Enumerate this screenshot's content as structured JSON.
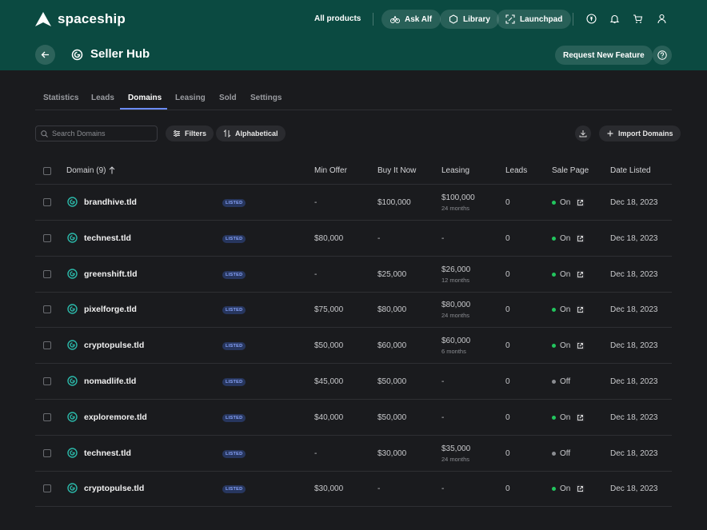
{
  "brand": {
    "name": "spaceship"
  },
  "nav": {
    "all_products": "All products",
    "ask_alf": "Ask Alf",
    "library": "Library",
    "launchpad": "Launchpad"
  },
  "hub": {
    "title": "Seller Hub",
    "request_feature": "Request New Feature"
  },
  "tabs": [
    "Statistics",
    "Leads",
    "Domains",
    "Leasing",
    "Sold",
    "Settings"
  ],
  "active_tab": "Domains",
  "toolbar": {
    "search_placeholder": "Search Domains",
    "filters": "Filters",
    "sort": "Alphabetical",
    "import": "Import Domains"
  },
  "columns": {
    "domain": "Domain (9)",
    "min_offer": "Min Offer",
    "buy_it_now": "Buy It Now",
    "leasing": "Leasing",
    "leads": "Leads",
    "sale_page": "Sale Page",
    "date_listed": "Date Listed"
  },
  "colors": {
    "on": "#22c55e",
    "off": "#8b8d92",
    "accent": "#0b4a41",
    "domain_icon": "#2bb7a8"
  },
  "rows": [
    {
      "domain": "brandhive.tld",
      "badge": "LISTED",
      "min_offer": "-",
      "buy_it_now": "$100,000",
      "leasing": "$100,000",
      "leasing_term": "24 months",
      "leads": "0",
      "sale_page": "On",
      "date": "Dec 18, 2023"
    },
    {
      "domain": "technest.tld",
      "badge": "LISTED",
      "min_offer": "$80,000",
      "buy_it_now": "-",
      "leasing": "-",
      "leasing_term": "",
      "leads": "0",
      "sale_page": "On",
      "date": "Dec 18, 2023"
    },
    {
      "domain": "greenshift.tld",
      "badge": "LISTED",
      "min_offer": "-",
      "buy_it_now": "$25,000",
      "leasing": "$26,000",
      "leasing_term": "12 months",
      "leads": "0",
      "sale_page": "On",
      "date": "Dec 18, 2023"
    },
    {
      "domain": "pixelforge.tld",
      "badge": "LISTED",
      "min_offer": "$75,000",
      "buy_it_now": "$80,000",
      "leasing": "$80,000",
      "leasing_term": "24 months",
      "leads": "0",
      "sale_page": "On",
      "date": "Dec 18, 2023"
    },
    {
      "domain": "cryptopulse.tld",
      "badge": "LISTED",
      "min_offer": "$50,000",
      "buy_it_now": "$60,000",
      "leasing": "$60,000",
      "leasing_term": "6 months",
      "leads": "0",
      "sale_page": "On",
      "date": "Dec 18, 2023"
    },
    {
      "domain": "nomadlife.tld",
      "badge": "LISTED",
      "min_offer": "$45,000",
      "buy_it_now": "$50,000",
      "leasing": "-",
      "leasing_term": "",
      "leads": "0",
      "sale_page": "Off",
      "date": "Dec 18, 2023"
    },
    {
      "domain": "exploremore.tld",
      "badge": "LISTED",
      "min_offer": "$40,000",
      "buy_it_now": "$50,000",
      "leasing": "-",
      "leasing_term": "",
      "leads": "0",
      "sale_page": "On",
      "date": "Dec 18, 2023"
    },
    {
      "domain": "technest.tld",
      "badge": "LISTED",
      "min_offer": "-",
      "buy_it_now": "$30,000",
      "leasing": "$35,000",
      "leasing_term": "24 months",
      "leads": "0",
      "sale_page": "Off",
      "date": "Dec 18, 2023"
    },
    {
      "domain": "cryptopulse.tld",
      "badge": "LISTED",
      "min_offer": "$30,000",
      "buy_it_now": "-",
      "leasing": "-",
      "leasing_term": "",
      "leads": "0",
      "sale_page": "On",
      "date": "Dec 18, 2023"
    }
  ]
}
